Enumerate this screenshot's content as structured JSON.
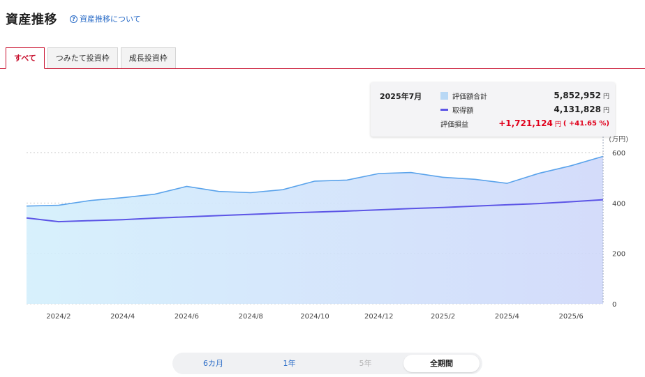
{
  "header": {
    "title": "資産推移",
    "help_link": "資産推移について",
    "help_icon": "?"
  },
  "tabs": [
    {
      "label": "すべて",
      "active": true
    },
    {
      "label": "つみたて投資枠",
      "active": false
    },
    {
      "label": "成長投資枠",
      "active": false
    }
  ],
  "tooltip": {
    "date": "2025年7月",
    "valuation_label": "評価額合計",
    "valuation_value": "5,852,952",
    "cost_label": "取得額",
    "cost_value": "4,131,828",
    "gain_label": "評価損益",
    "gain_value": "+1,721,124",
    "gain_pct": "( +41.65 %)",
    "unit": "円"
  },
  "period_selector": {
    "options": [
      {
        "label": "6カ月",
        "state": "link"
      },
      {
        "label": "1年",
        "state": "link"
      },
      {
        "label": "5年",
        "state": "disabled"
      },
      {
        "label": "全期間",
        "state": "selected"
      }
    ]
  },
  "colors": {
    "valuation_line": "#5aa3eb",
    "cost_line": "#5c55e6",
    "fill_left": "#d3effc",
    "fill_right": "#cfd8fa",
    "accent_red": "#c8102e",
    "gain_red": "#e0001b"
  },
  "chart_data": {
    "type": "area",
    "unit_label": "(万円)",
    "ylim": [
      0,
      600
    ],
    "y_ticks": [
      "600",
      "400",
      "200",
      "0"
    ],
    "y_tick_values": [
      600,
      400,
      200,
      0
    ],
    "x": [
      "2024/1",
      "2024/2",
      "2024/3",
      "2024/4",
      "2024/5",
      "2024/6",
      "2024/7",
      "2024/8",
      "2024/9",
      "2024/10",
      "2024/11",
      "2024/12",
      "2025/1",
      "2025/2",
      "2025/3",
      "2025/4",
      "2025/5",
      "2025/6",
      "2025/7"
    ],
    "x_tick_labels": [
      "2024/2",
      "2024/4",
      "2024/6",
      "2024/8",
      "2024/10",
      "2024/12",
      "2025/2",
      "2025/4",
      "2025/6"
    ],
    "series": [
      {
        "name": "評価額合計",
        "values": [
          388,
          391,
          410,
          421,
          435,
          466,
          446,
          441,
          453,
          487,
          491,
          517,
          521,
          502,
          494,
          478,
          518,
          548,
          585
        ]
      },
      {
        "name": "取得額",
        "values": [
          341,
          326,
          330,
          334,
          340,
          345,
          350,
          355,
          360,
          364,
          368,
          373,
          378,
          382,
          388,
          393,
          398,
          405,
          413
        ]
      }
    ],
    "legend_position": "top-right",
    "grid": true
  }
}
